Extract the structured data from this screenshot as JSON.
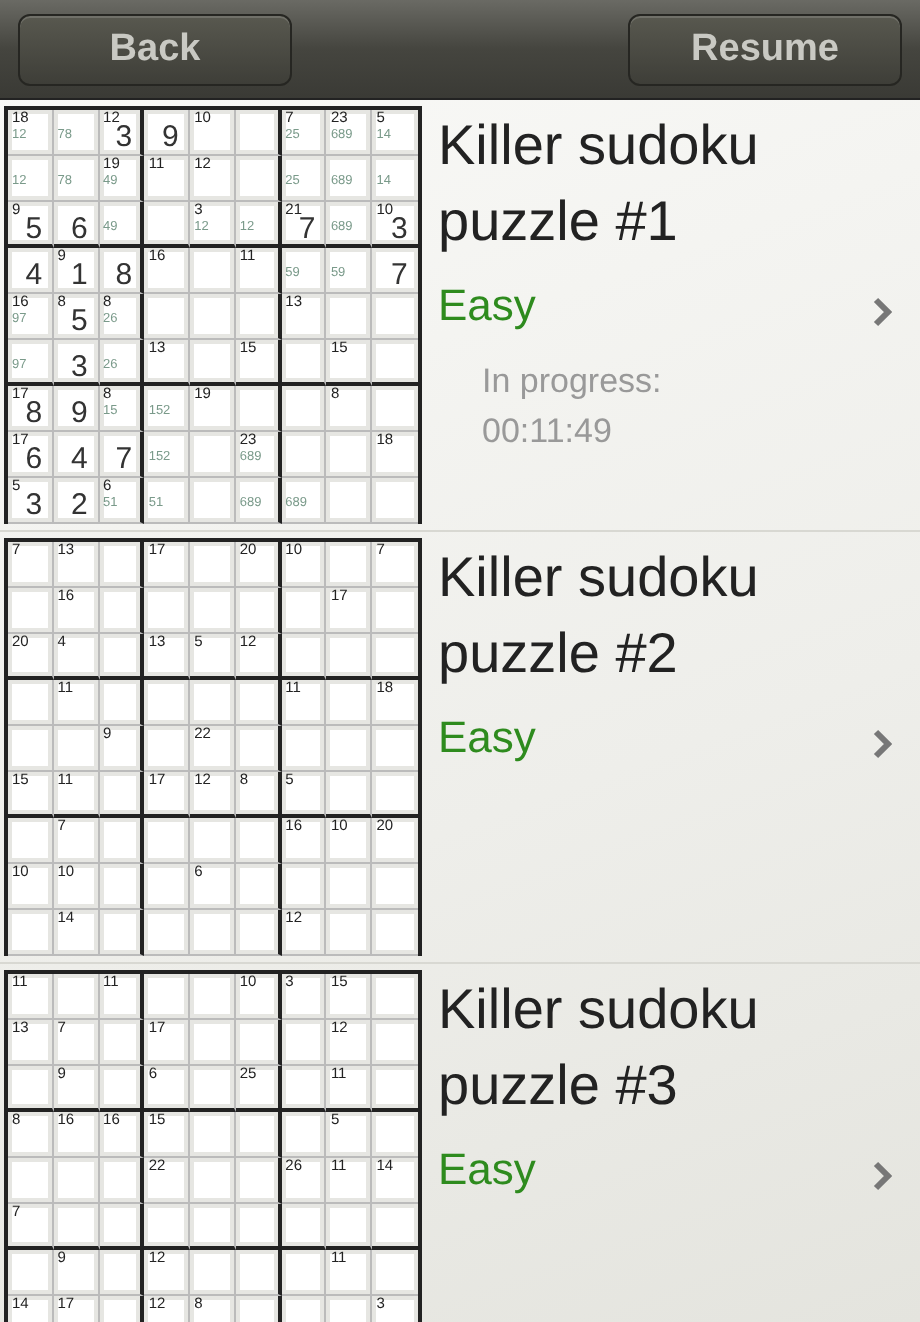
{
  "toolbar": {
    "back": "Back",
    "resume": "Resume"
  },
  "puzzles": [
    {
      "title": "Killer sudoku puzzle #1",
      "difficulty": "Easy",
      "progress_label": "In progress:",
      "progress_time": "00:11:49",
      "grid": [
        [
          {
            "kind": "clue",
            "sum": "18",
            "notes": "12"
          },
          {
            "kind": "clue",
            "notes": "78"
          },
          {
            "kind": "clue",
            "sum": "12",
            "value": "3"
          },
          {
            "kind": "clue",
            "value": "9"
          },
          {
            "kind": "clue",
            "sum": "10"
          },
          {
            "kind": "blank"
          },
          {
            "kind": "clue",
            "sum": "7",
            "notes": "25"
          },
          {
            "kind": "clue",
            "sum": "23",
            "notes": "689"
          },
          {
            "kind": "clue",
            "sum": "5",
            "notes": "14"
          }
        ],
        [
          {
            "kind": "clue",
            "notes": "12"
          },
          {
            "kind": "clue",
            "notes": "78"
          },
          {
            "kind": "clue",
            "sum": "19",
            "notes": "49"
          },
          {
            "kind": "clue",
            "sum": "11"
          },
          {
            "kind": "clue",
            "sum": "12"
          },
          {
            "kind": "blank"
          },
          {
            "kind": "clue",
            "notes": "25"
          },
          {
            "kind": "clue",
            "notes": "689"
          },
          {
            "kind": "clue",
            "notes": "14"
          }
        ],
        [
          {
            "kind": "clue",
            "sum": "9",
            "value": "5"
          },
          {
            "kind": "clue",
            "value": "6"
          },
          {
            "kind": "clue",
            "notes": "49"
          },
          {
            "kind": "blank"
          },
          {
            "kind": "clue",
            "sum": "3",
            "notes": "12"
          },
          {
            "kind": "clue",
            "notes": "12"
          },
          {
            "kind": "clue",
            "sum": "21",
            "value": "7"
          },
          {
            "kind": "clue",
            "notes": "689"
          },
          {
            "kind": "clue",
            "sum": "10",
            "value": "3"
          }
        ],
        [
          {
            "kind": "clue",
            "value": "4"
          },
          {
            "kind": "clue",
            "sum": "9",
            "value": "1"
          },
          {
            "kind": "clue",
            "value": "8"
          },
          {
            "kind": "clue",
            "sum": "16"
          },
          {
            "kind": "blank"
          },
          {
            "kind": "clue",
            "sum": "11"
          },
          {
            "kind": "clue",
            "notes": "59"
          },
          {
            "kind": "clue",
            "notes": "59"
          },
          {
            "kind": "clue",
            "value": "7"
          }
        ],
        [
          {
            "kind": "clue",
            "sum": "16",
            "notes": "97"
          },
          {
            "kind": "clue",
            "sum": "8",
            "value": "5"
          },
          {
            "kind": "clue",
            "sum": "8",
            "notes": "26"
          },
          {
            "kind": "blank"
          },
          {
            "kind": "blank"
          },
          {
            "kind": "blank"
          },
          {
            "kind": "clue",
            "sum": "13"
          },
          {
            "kind": "blank"
          },
          {
            "kind": "blank"
          }
        ],
        [
          {
            "kind": "clue",
            "notes": "97"
          },
          {
            "kind": "clue",
            "value": "3"
          },
          {
            "kind": "clue",
            "notes": "26"
          },
          {
            "kind": "clue",
            "sum": "13"
          },
          {
            "kind": "blank"
          },
          {
            "kind": "clue",
            "sum": "15"
          },
          {
            "kind": "blank"
          },
          {
            "kind": "clue",
            "sum": "15"
          },
          {
            "kind": "blank"
          }
        ],
        [
          {
            "kind": "clue",
            "sum": "17",
            "value": "8"
          },
          {
            "kind": "clue",
            "value": "9"
          },
          {
            "kind": "clue",
            "sum": "8",
            "notes": "15"
          },
          {
            "kind": "clue",
            "notes": "152"
          },
          {
            "kind": "clue",
            "sum": "19"
          },
          {
            "kind": "blank"
          },
          {
            "kind": "blank"
          },
          {
            "kind": "clue",
            "sum": "8"
          },
          {
            "kind": "blank"
          }
        ],
        [
          {
            "kind": "clue",
            "sum": "17",
            "value": "6"
          },
          {
            "kind": "clue",
            "value": "4"
          },
          {
            "kind": "clue",
            "value": "7"
          },
          {
            "kind": "clue",
            "notes": "152"
          },
          {
            "kind": "blank"
          },
          {
            "kind": "clue",
            "sum": "23",
            "notes": "689"
          },
          {
            "kind": "blank"
          },
          {
            "kind": "blank"
          },
          {
            "kind": "clue",
            "sum": "18"
          }
        ],
        [
          {
            "kind": "clue",
            "sum": "5",
            "value": "3"
          },
          {
            "kind": "clue",
            "value": "2"
          },
          {
            "kind": "clue",
            "sum": "6",
            "notes": "51"
          },
          {
            "kind": "clue",
            "notes": "51"
          },
          {
            "kind": "blank"
          },
          {
            "kind": "clue",
            "notes": "689"
          },
          {
            "kind": "clue",
            "notes": "689"
          },
          {
            "kind": "blank"
          },
          {
            "kind": "blank"
          }
        ]
      ]
    },
    {
      "title": "Killer sudoku puzzle #2",
      "difficulty": "Easy",
      "grid": [
        [
          {
            "kind": "clue",
            "sum": "7"
          },
          {
            "kind": "clue",
            "sum": "13"
          },
          {
            "kind": "blank"
          },
          {
            "kind": "clue",
            "sum": "17"
          },
          {
            "kind": "blank"
          },
          {
            "kind": "clue",
            "sum": "20"
          },
          {
            "kind": "clue",
            "sum": "10"
          },
          {
            "kind": "blank"
          },
          {
            "kind": "clue",
            "sum": "7"
          }
        ],
        [
          {
            "kind": "blank"
          },
          {
            "kind": "clue",
            "sum": "16"
          },
          {
            "kind": "blank"
          },
          {
            "kind": "blank"
          },
          {
            "kind": "blank"
          },
          {
            "kind": "blank"
          },
          {
            "kind": "blank"
          },
          {
            "kind": "clue",
            "sum": "17"
          },
          {
            "kind": "blank"
          }
        ],
        [
          {
            "kind": "clue",
            "sum": "20"
          },
          {
            "kind": "clue",
            "sum": "4"
          },
          {
            "kind": "blank"
          },
          {
            "kind": "clue",
            "sum": "13"
          },
          {
            "kind": "clue",
            "sum": "5"
          },
          {
            "kind": "clue",
            "sum": "12"
          },
          {
            "kind": "blank"
          },
          {
            "kind": "blank"
          },
          {
            "kind": "blank"
          }
        ],
        [
          {
            "kind": "blank"
          },
          {
            "kind": "clue",
            "sum": "11"
          },
          {
            "kind": "blank"
          },
          {
            "kind": "blank"
          },
          {
            "kind": "blank"
          },
          {
            "kind": "blank"
          },
          {
            "kind": "clue",
            "sum": "11"
          },
          {
            "kind": "blank"
          },
          {
            "kind": "clue",
            "sum": "18"
          }
        ],
        [
          {
            "kind": "blank"
          },
          {
            "kind": "blank"
          },
          {
            "kind": "clue",
            "sum": "9"
          },
          {
            "kind": "blank"
          },
          {
            "kind": "clue",
            "sum": "22"
          },
          {
            "kind": "blank"
          },
          {
            "kind": "blank"
          },
          {
            "kind": "blank"
          },
          {
            "kind": "blank"
          }
        ],
        [
          {
            "kind": "clue",
            "sum": "15"
          },
          {
            "kind": "clue",
            "sum": "11"
          },
          {
            "kind": "blank"
          },
          {
            "kind": "clue",
            "sum": "17"
          },
          {
            "kind": "clue",
            "sum": "12"
          },
          {
            "kind": "clue",
            "sum": "8"
          },
          {
            "kind": "clue",
            "sum": "5"
          },
          {
            "kind": "blank"
          },
          {
            "kind": "blank"
          }
        ],
        [
          {
            "kind": "blank"
          },
          {
            "kind": "clue",
            "sum": "7"
          },
          {
            "kind": "blank"
          },
          {
            "kind": "blank"
          },
          {
            "kind": "blank"
          },
          {
            "kind": "blank"
          },
          {
            "kind": "clue",
            "sum": "16"
          },
          {
            "kind": "clue",
            "sum": "10"
          },
          {
            "kind": "clue",
            "sum": "20"
          }
        ],
        [
          {
            "kind": "clue",
            "sum": "10"
          },
          {
            "kind": "clue",
            "sum": "10"
          },
          {
            "kind": "blank"
          },
          {
            "kind": "blank"
          },
          {
            "kind": "clue",
            "sum": "6"
          },
          {
            "kind": "blank"
          },
          {
            "kind": "blank"
          },
          {
            "kind": "blank"
          },
          {
            "kind": "blank"
          }
        ],
        [
          {
            "kind": "blank"
          },
          {
            "kind": "clue",
            "sum": "14"
          },
          {
            "kind": "blank"
          },
          {
            "kind": "blank"
          },
          {
            "kind": "blank"
          },
          {
            "kind": "blank"
          },
          {
            "kind": "clue",
            "sum": "12"
          },
          {
            "kind": "blank"
          },
          {
            "kind": "blank"
          }
        ]
      ]
    },
    {
      "title": "Killer sudoku puzzle #3",
      "difficulty": "Easy",
      "grid": [
        [
          {
            "kind": "clue",
            "sum": "11"
          },
          {
            "kind": "blank"
          },
          {
            "kind": "clue",
            "sum": "11"
          },
          {
            "kind": "blank"
          },
          {
            "kind": "blank"
          },
          {
            "kind": "clue",
            "sum": "10"
          },
          {
            "kind": "clue",
            "sum": "3"
          },
          {
            "kind": "clue",
            "sum": "15"
          },
          {
            "kind": "blank"
          }
        ],
        [
          {
            "kind": "clue",
            "sum": "13"
          },
          {
            "kind": "clue",
            "sum": "7"
          },
          {
            "kind": "blank"
          },
          {
            "kind": "clue",
            "sum": "17"
          },
          {
            "kind": "blank"
          },
          {
            "kind": "blank"
          },
          {
            "kind": "blank"
          },
          {
            "kind": "clue",
            "sum": "12"
          },
          {
            "kind": "blank"
          }
        ],
        [
          {
            "kind": "blank"
          },
          {
            "kind": "clue",
            "sum": "9"
          },
          {
            "kind": "blank"
          },
          {
            "kind": "clue",
            "sum": "6"
          },
          {
            "kind": "blank"
          },
          {
            "kind": "clue",
            "sum": "25"
          },
          {
            "kind": "blank"
          },
          {
            "kind": "clue",
            "sum": "11"
          },
          {
            "kind": "blank"
          }
        ],
        [
          {
            "kind": "clue",
            "sum": "8"
          },
          {
            "kind": "clue",
            "sum": "16"
          },
          {
            "kind": "clue",
            "sum": "16"
          },
          {
            "kind": "clue",
            "sum": "15"
          },
          {
            "kind": "blank"
          },
          {
            "kind": "blank"
          },
          {
            "kind": "blank"
          },
          {
            "kind": "clue",
            "sum": "5"
          },
          {
            "kind": "blank"
          }
        ],
        [
          {
            "kind": "blank"
          },
          {
            "kind": "blank"
          },
          {
            "kind": "blank"
          },
          {
            "kind": "clue",
            "sum": "22"
          },
          {
            "kind": "blank"
          },
          {
            "kind": "blank"
          },
          {
            "kind": "clue",
            "sum": "26"
          },
          {
            "kind": "clue",
            "sum": "11"
          },
          {
            "kind": "clue",
            "sum": "14"
          }
        ],
        [
          {
            "kind": "clue",
            "sum": "7"
          },
          {
            "kind": "blank"
          },
          {
            "kind": "blank"
          },
          {
            "kind": "blank"
          },
          {
            "kind": "blank"
          },
          {
            "kind": "blank"
          },
          {
            "kind": "blank"
          },
          {
            "kind": "blank"
          },
          {
            "kind": "blank"
          }
        ],
        [
          {
            "kind": "blank"
          },
          {
            "kind": "clue",
            "sum": "9"
          },
          {
            "kind": "blank"
          },
          {
            "kind": "clue",
            "sum": "12"
          },
          {
            "kind": "blank"
          },
          {
            "kind": "blank"
          },
          {
            "kind": "blank"
          },
          {
            "kind": "clue",
            "sum": "11"
          },
          {
            "kind": "blank"
          }
        ],
        [
          {
            "kind": "clue",
            "sum": "14"
          },
          {
            "kind": "clue",
            "sum": "17"
          },
          {
            "kind": "blank"
          },
          {
            "kind": "clue",
            "sum": "12"
          },
          {
            "kind": "clue",
            "sum": "8"
          },
          {
            "kind": "blank"
          },
          {
            "kind": "blank"
          },
          {
            "kind": "blank"
          },
          {
            "kind": "clue",
            "sum": "3"
          }
        ]
      ]
    }
  ]
}
